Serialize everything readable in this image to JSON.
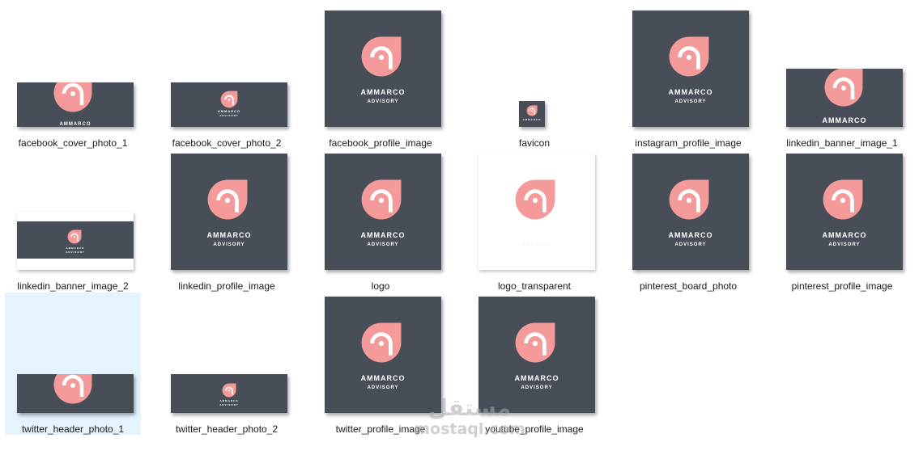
{
  "colors": {
    "tile_dark": "#474e57",
    "logo_pink": "#f59a9a",
    "selection": "#e5f3ff"
  },
  "logo_icon": "ammarco-logo-icon",
  "brand": {
    "name": "AMMARCO",
    "tagline": "ADVISORY"
  },
  "files": [
    {
      "name": "facebook_cover_photo_1"
    },
    {
      "name": "facebook_cover_photo_2"
    },
    {
      "name": "facebook_profile_image"
    },
    {
      "name": "favicon"
    },
    {
      "name": "instagram_profile_image"
    },
    {
      "name": "linkedin_banner_image_1"
    },
    {
      "name": "linkedin_banner_image_2"
    },
    {
      "name": "linkedin_profile_image"
    },
    {
      "name": "logo"
    },
    {
      "name": "logo_transparent"
    },
    {
      "name": "pinterest_board_photo"
    },
    {
      "name": "pinterest_profile_image"
    },
    {
      "name": "twitter_header_photo_1",
      "selected": true
    },
    {
      "name": "twitter_header_photo_2"
    },
    {
      "name": "twitter_profile_image"
    },
    {
      "name": "youtube_profile_image"
    }
  ],
  "watermark": {
    "arabic": "مستقل",
    "latin": "mostaql.com"
  }
}
